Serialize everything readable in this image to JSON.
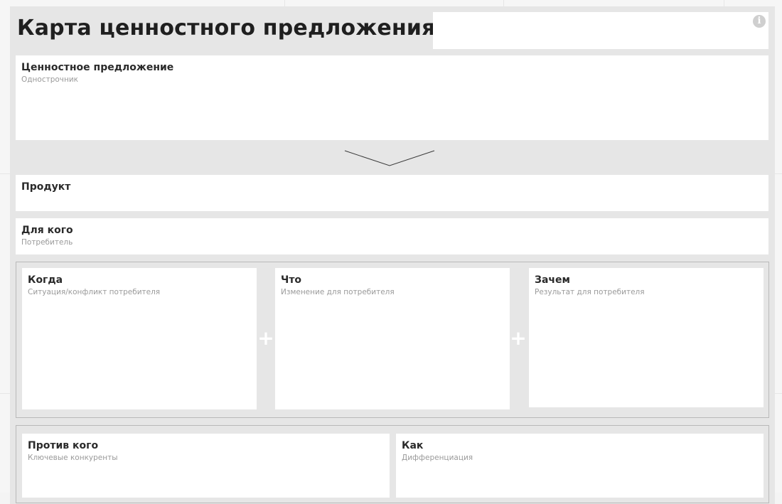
{
  "page": {
    "title": "Карта ценностного предложения"
  },
  "info": {
    "icon": "info-icon",
    "glyph": "i"
  },
  "cards": {
    "value_prop": {
      "title": "Ценностное предложение",
      "subtitle": "Однострочник"
    },
    "product": {
      "title": "Продукт"
    },
    "for_whom": {
      "title": "Для кого",
      "subtitle": "Потребитель"
    },
    "when": {
      "title": "Когда",
      "subtitle": "Ситуация/конфликт потребителя"
    },
    "what": {
      "title": "Что",
      "subtitle": "Изменение для потребителя"
    },
    "why": {
      "title": "Зачем",
      "subtitle": "Результат для потребителя"
    },
    "against": {
      "title": "Против кого",
      "subtitle": "Ключевые конкуренты"
    },
    "how": {
      "title": "Как",
      "subtitle": "Дифференциация"
    }
  },
  "connectors": {
    "plus_glyph": "+"
  },
  "colors": {
    "canvas": "#e6e6e6",
    "card": "#ffffff",
    "title_text": "#1f1f1f",
    "subtitle_text": "#9a9a9a"
  }
}
